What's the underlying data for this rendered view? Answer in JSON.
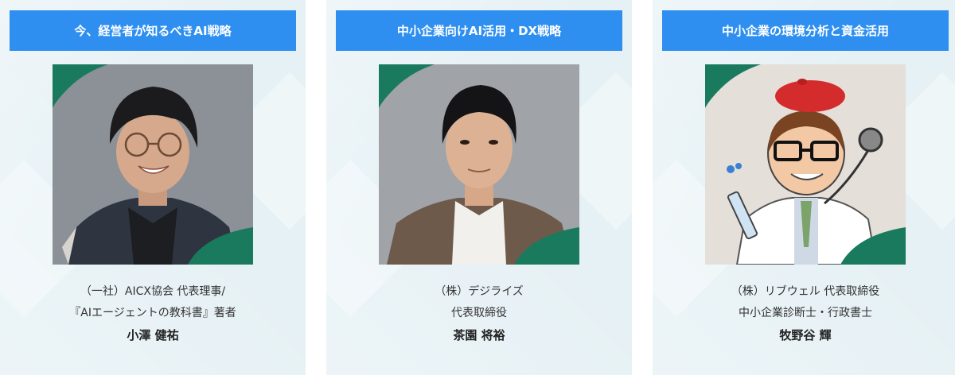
{
  "cards": [
    {
      "title": "今、経営者が知るべきAI戦略",
      "line1": "（一社）AICX協会 代表理事/",
      "line2": "『AIエージェントの教科書』著者",
      "name": "小澤 健祐",
      "photo_bg": "#8a8f96"
    },
    {
      "title": "中小企業向けAI活用・DX戦略",
      "line1": "（株）デジライズ",
      "line2": "代表取締役",
      "name": "茶園 将裕",
      "photo_bg": "#9ea1a6"
    },
    {
      "title": "中小企業の環境分析と資金活用",
      "line1": "（株）リブウェル 代表取締役",
      "line2": "中小企業診断士・行政書士",
      "name": "牧野谷 輝",
      "photo_bg": "#e3ddd8"
    }
  ],
  "colors": {
    "header": "#2e8ff0",
    "accent_green": "#1a7a5e",
    "card_bg": "#e6f1f5"
  }
}
